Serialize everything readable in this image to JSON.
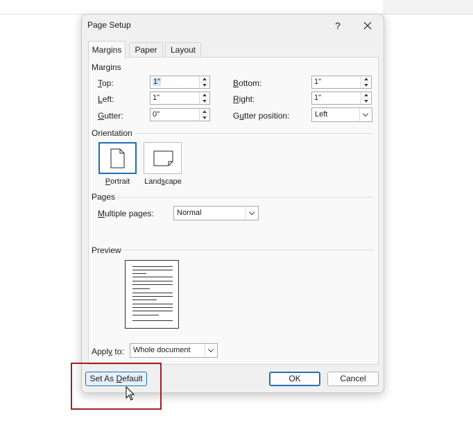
{
  "dialog": {
    "title": "Page Setup",
    "help": "?",
    "tabs": [
      "Margins",
      "Paper",
      "Layout"
    ],
    "active_tab": "Margins"
  },
  "margins": {
    "section_label": "Margins",
    "top": {
      "label_u": "T",
      "label_rest": "op:",
      "value": "1\""
    },
    "left": {
      "label_u": "L",
      "label_rest": "eft:",
      "value": "1\""
    },
    "gutter": {
      "label_u": "G",
      "label_rest": "utter:",
      "value": "0\""
    },
    "bottom": {
      "label_u": "B",
      "label_rest": "ottom:",
      "value": "1\""
    },
    "right": {
      "label_u": "R",
      "label_rest": "ight:",
      "value": "1\""
    },
    "gutter_position": {
      "label_pre": "G",
      "label_u": "u",
      "label_rest": "tter position:",
      "value": "Left"
    }
  },
  "orientation": {
    "section_label": "Orientation",
    "portrait": {
      "label_u": "P",
      "label_rest": "ortrait",
      "selected": true
    },
    "landscape": {
      "label_pre": "Land",
      "label_u": "s",
      "label_rest": "cape",
      "selected": false
    }
  },
  "pages": {
    "section_label": "Pages",
    "multiple_pages": {
      "label_u": "M",
      "label_rest": "ultiple pages:",
      "value": "Normal"
    }
  },
  "preview": {
    "section_label": "Preview",
    "apply_to": {
      "label_pre": "Appl",
      "label_u": "y",
      "label_rest": " to:",
      "value": "Whole document"
    }
  },
  "buttons": {
    "set_default": {
      "label_pre": "Set As ",
      "label_u": "D",
      "label_rest": "efault"
    },
    "ok": "OK",
    "cancel": "Cancel"
  },
  "colors": {
    "accent": "#1d6fb8",
    "highlight_box": "#a11f22",
    "dialog_bg": "#f0f0f0",
    "panel_bg": "#f9f9f9"
  }
}
